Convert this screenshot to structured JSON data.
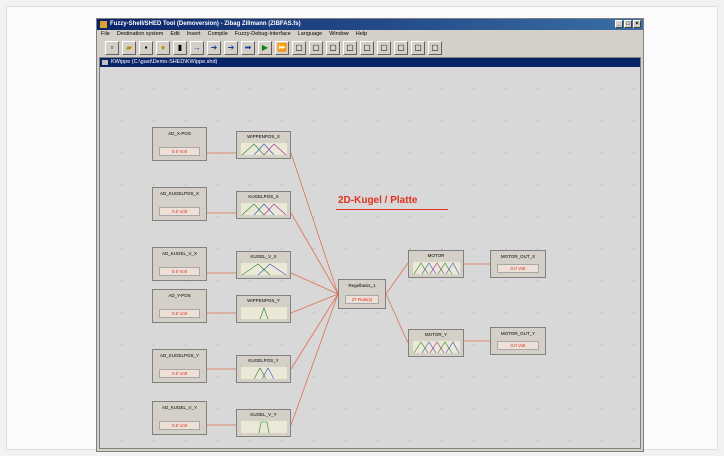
{
  "app": {
    "title": "Fuzzy-Shell/SHED Tool (Demoversion) - Zibag Zillmann (ZIBFAS.fs)",
    "menu": [
      "File",
      "Destination system",
      "Edit",
      "Insert",
      "Compile",
      "Fuzzy-Debug-Interface",
      "Language",
      "Window",
      "Help"
    ],
    "toolbar_icons": [
      "new-icon",
      "open-icon",
      "save-icon",
      "lightbulb-icon",
      "compile-icon",
      "arrow-right-icon",
      "run-icon",
      "step-icon",
      "forward-icon",
      "debug-start-icon",
      "debug-run-icon",
      "box-icon",
      "box-icon",
      "box-icon",
      "box-icon",
      "box-icon",
      "box-icon",
      "box-icon",
      "box-icon",
      "box-icon"
    ]
  },
  "document": {
    "title": "KWippe (C:\\gast\\Demo-SHED\\KWippe.shd)"
  },
  "diagram": {
    "heading": "2D-Kugel / Platte",
    "inputs": [
      {
        "name": "AD_X-POS",
        "value": "0.0 Volt"
      },
      {
        "name": "AD_KUGELPOS_X",
        "value": "0.0 Volt"
      },
      {
        "name": "AD_KUGEL_V_X",
        "value": "0.0 Volt"
      },
      {
        "name": "AD_Y-POS",
        "value": "0.0 Volt"
      },
      {
        "name": "AD_KUGELPOS_Y",
        "value": "0.0 Volt"
      },
      {
        "name": "AD_KUGEL_V_Y",
        "value": "0.0 Volt"
      }
    ],
    "fuzzy_sets": [
      {
        "name": "WIPPENPOS_X"
      },
      {
        "name": "KUGELPOS_X"
      },
      {
        "name": "KUGEL_V_X"
      },
      {
        "name": "WIPPENPOS_Y"
      },
      {
        "name": "KUGELPOS_Y"
      },
      {
        "name": "KUGEL_V_Y"
      }
    ],
    "rulebase": {
      "name": "Regelbasis_1",
      "value": "27 Rule(s)"
    },
    "out_sets": [
      {
        "name": "MOTOR"
      },
      {
        "name": "MOTOR_Y"
      }
    ],
    "outputs": [
      {
        "name": "MOTOR_OUT_X",
        "value": "0.0 Volt"
      },
      {
        "name": "MOTOR_OUT_Y",
        "value": "0.0 Volt"
      }
    ],
    "colors": {
      "wire": "#e07050",
      "accent": "#e03020",
      "set_curve_1": "#208020",
      "set_curve_2": "#3050c0",
      "set_curve_3": "#a02090"
    }
  }
}
